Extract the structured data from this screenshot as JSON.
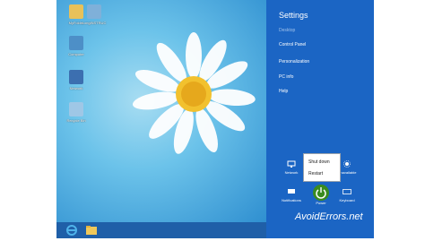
{
  "desktop": {
    "icons": [
      {
        "label": "MyFolder",
        "icon": "folder-icon"
      },
      {
        "label": "LongINSTRUC",
        "icon": "computer-icon"
      },
      {
        "label": "Computer",
        "icon": "computer-icon"
      },
      {
        "label": "Network",
        "icon": "network-icon"
      },
      {
        "label": "Recycle Bin",
        "icon": "recycle-bin-icon"
      }
    ]
  },
  "taskbar": {
    "buttons": [
      {
        "icon": "internet-explorer-icon"
      },
      {
        "icon": "file-explorer-icon"
      }
    ]
  },
  "charms": {
    "title": "Settings",
    "links": [
      "Desktop",
      "Control Panel",
      "Personalization",
      "PC info",
      "Help"
    ],
    "tiles": [
      {
        "label": "Network",
        "icon": "network-icon"
      },
      {
        "label": "Unavailable",
        "icon": "brightness-icon"
      },
      {
        "label": "Notifications",
        "icon": "notifications-icon"
      },
      {
        "label": "Power",
        "icon": "power-icon"
      },
      {
        "label": "Keyboard",
        "icon": "keyboard-icon"
      }
    ],
    "power_menu": [
      "Shut down",
      "Restart"
    ]
  },
  "watermark": "AvoidErrors.net",
  "colors": {
    "charms_bg": "#1b65c4",
    "taskbar_bg": "#1f5fa8",
    "power_accent": "#3a8b1f"
  }
}
